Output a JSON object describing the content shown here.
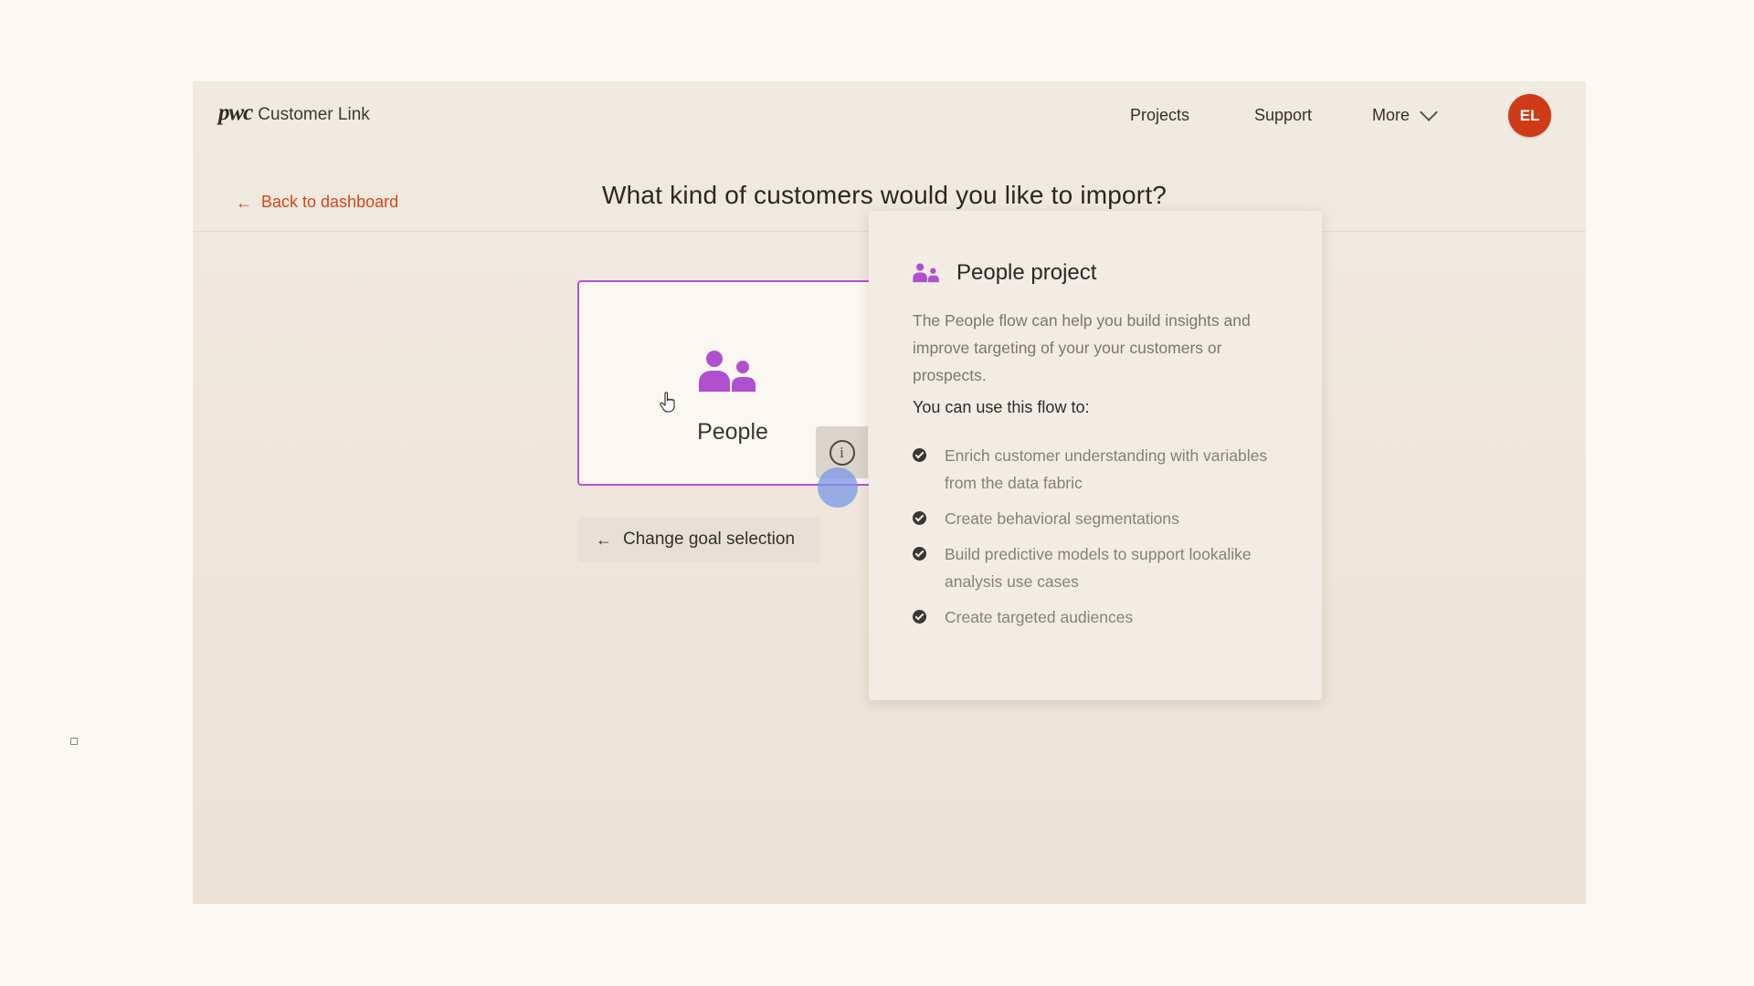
{
  "brand": {
    "logo_mark": "pwc",
    "app_name": "Customer Link"
  },
  "nav": {
    "projects": "Projects",
    "support": "Support",
    "more": "More"
  },
  "user": {
    "initials": "EL"
  },
  "subheader": {
    "back_label": "Back to dashboard",
    "title": "What kind of customers would you like to import?"
  },
  "card": {
    "label": "People",
    "icon": "people-icon",
    "selected": true
  },
  "change_goal": {
    "label": "Change goal selection"
  },
  "info_button": {
    "icon": "info-icon"
  },
  "panel": {
    "title": "People project",
    "icon": "people-icon",
    "description": "The People flow can help you build insights and improve targeting of your your customers or prospects.",
    "subheading": "You can use this flow to:",
    "items": [
      "Enrich customer understanding with variables from the data fabric",
      "Create behavioral segmentations",
      "Build predictive models to support lookalike analysis use cases",
      "Create targeted audiences"
    ]
  },
  "colors": {
    "accent_purple": "#b74fd0",
    "brand_orange": "#d4461a",
    "avatar": "#cf3b16"
  }
}
